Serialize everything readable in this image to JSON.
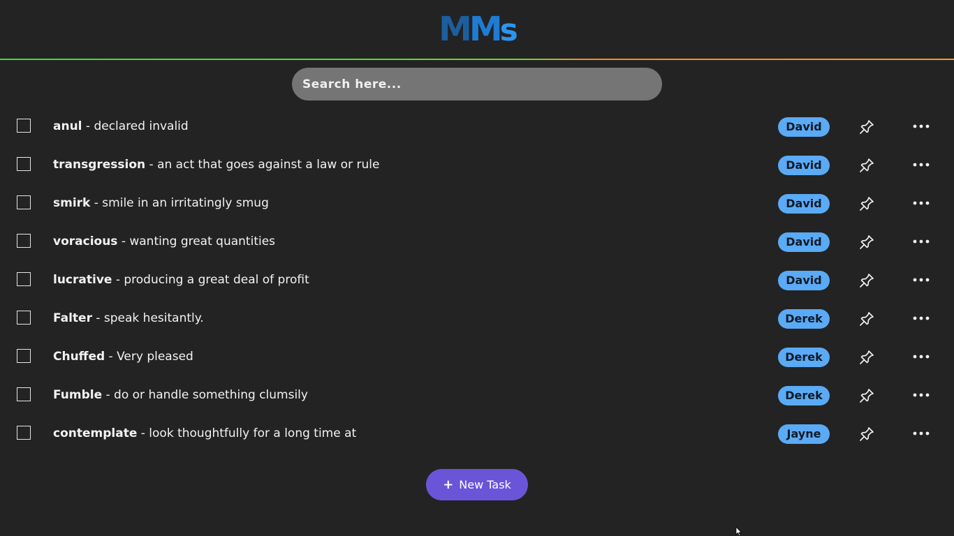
{
  "header": {
    "logo_part1": "M",
    "logo_part2": "M",
    "logo_part3": "s"
  },
  "search": {
    "placeholder": "Search here..."
  },
  "tasks": [
    {
      "term": "anul",
      "definition": " - declared invalid",
      "assignee": "David"
    },
    {
      "term": "transgression",
      "definition": " - an act that goes against a law or rule",
      "assignee": "David"
    },
    {
      "term": "smirk",
      "definition": " - smile in an irritatingly smug",
      "assignee": "David"
    },
    {
      "term": "voracious",
      "definition": " - wanting great quantities",
      "assignee": "David"
    },
    {
      "term": "lucrative",
      "definition": " - producing a great deal of profit",
      "assignee": "David"
    },
    {
      "term": "Falter",
      "definition": " - speak hesitantly.",
      "assignee": "Derek"
    },
    {
      "term": "Chuffed",
      "definition": " - Very pleased",
      "assignee": "Derek"
    },
    {
      "term": "Fumble",
      "definition": " - do or handle something clumsily",
      "assignee": "Derek"
    },
    {
      "term": "contemplate",
      "definition": " - look thoughtfully for a long time at",
      "assignee": "Jayne"
    }
  ],
  "actions": {
    "new_task_icon": "+",
    "new_task_label": "New Task"
  },
  "colors": {
    "background": "#232323",
    "assignee_badge": "#5aaaf5",
    "new_task_button": "#6a55d8",
    "divider_left": "#3cdc3c",
    "divider_right": "#ff9a22"
  }
}
